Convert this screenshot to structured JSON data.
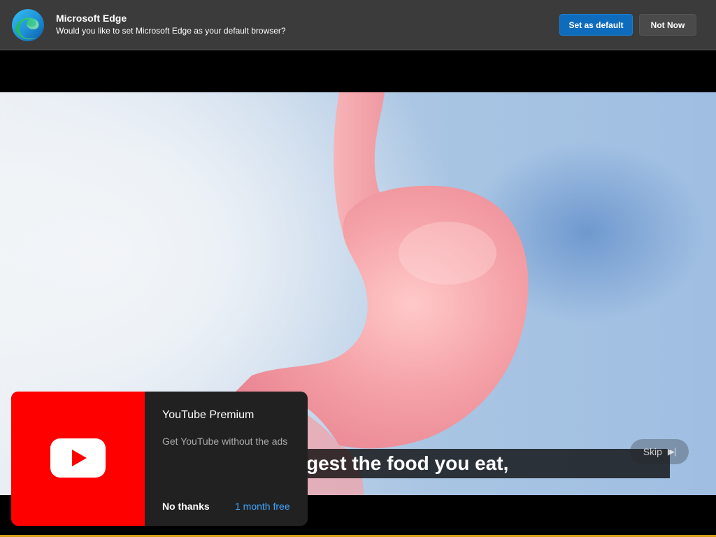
{
  "edge_prompt": {
    "title": "Microsoft Edge",
    "message": "Would you like to set Microsoft Edge as your default browser?",
    "primary_button": "Set as default",
    "secondary_button": "Not Now",
    "logo_icon": "edge-logo-icon"
  },
  "video": {
    "caption": "gest the food you eat,",
    "skip_label": "Skip",
    "skip_icon": "skip-next-icon"
  },
  "premium_popup": {
    "title": "YouTube Premium",
    "description": "Get YouTube without the ads",
    "dismiss_label": "No thanks",
    "trial_label": "1 month free",
    "logo_icon": "youtube-logo-icon",
    "brand_color": "#ff0000",
    "link_color": "#3ea6ff"
  },
  "colors": {
    "edge_bar_bg": "#3b3b3b",
    "edge_primary": "#0f6cbd",
    "accent_bottom": "#d4a017"
  }
}
